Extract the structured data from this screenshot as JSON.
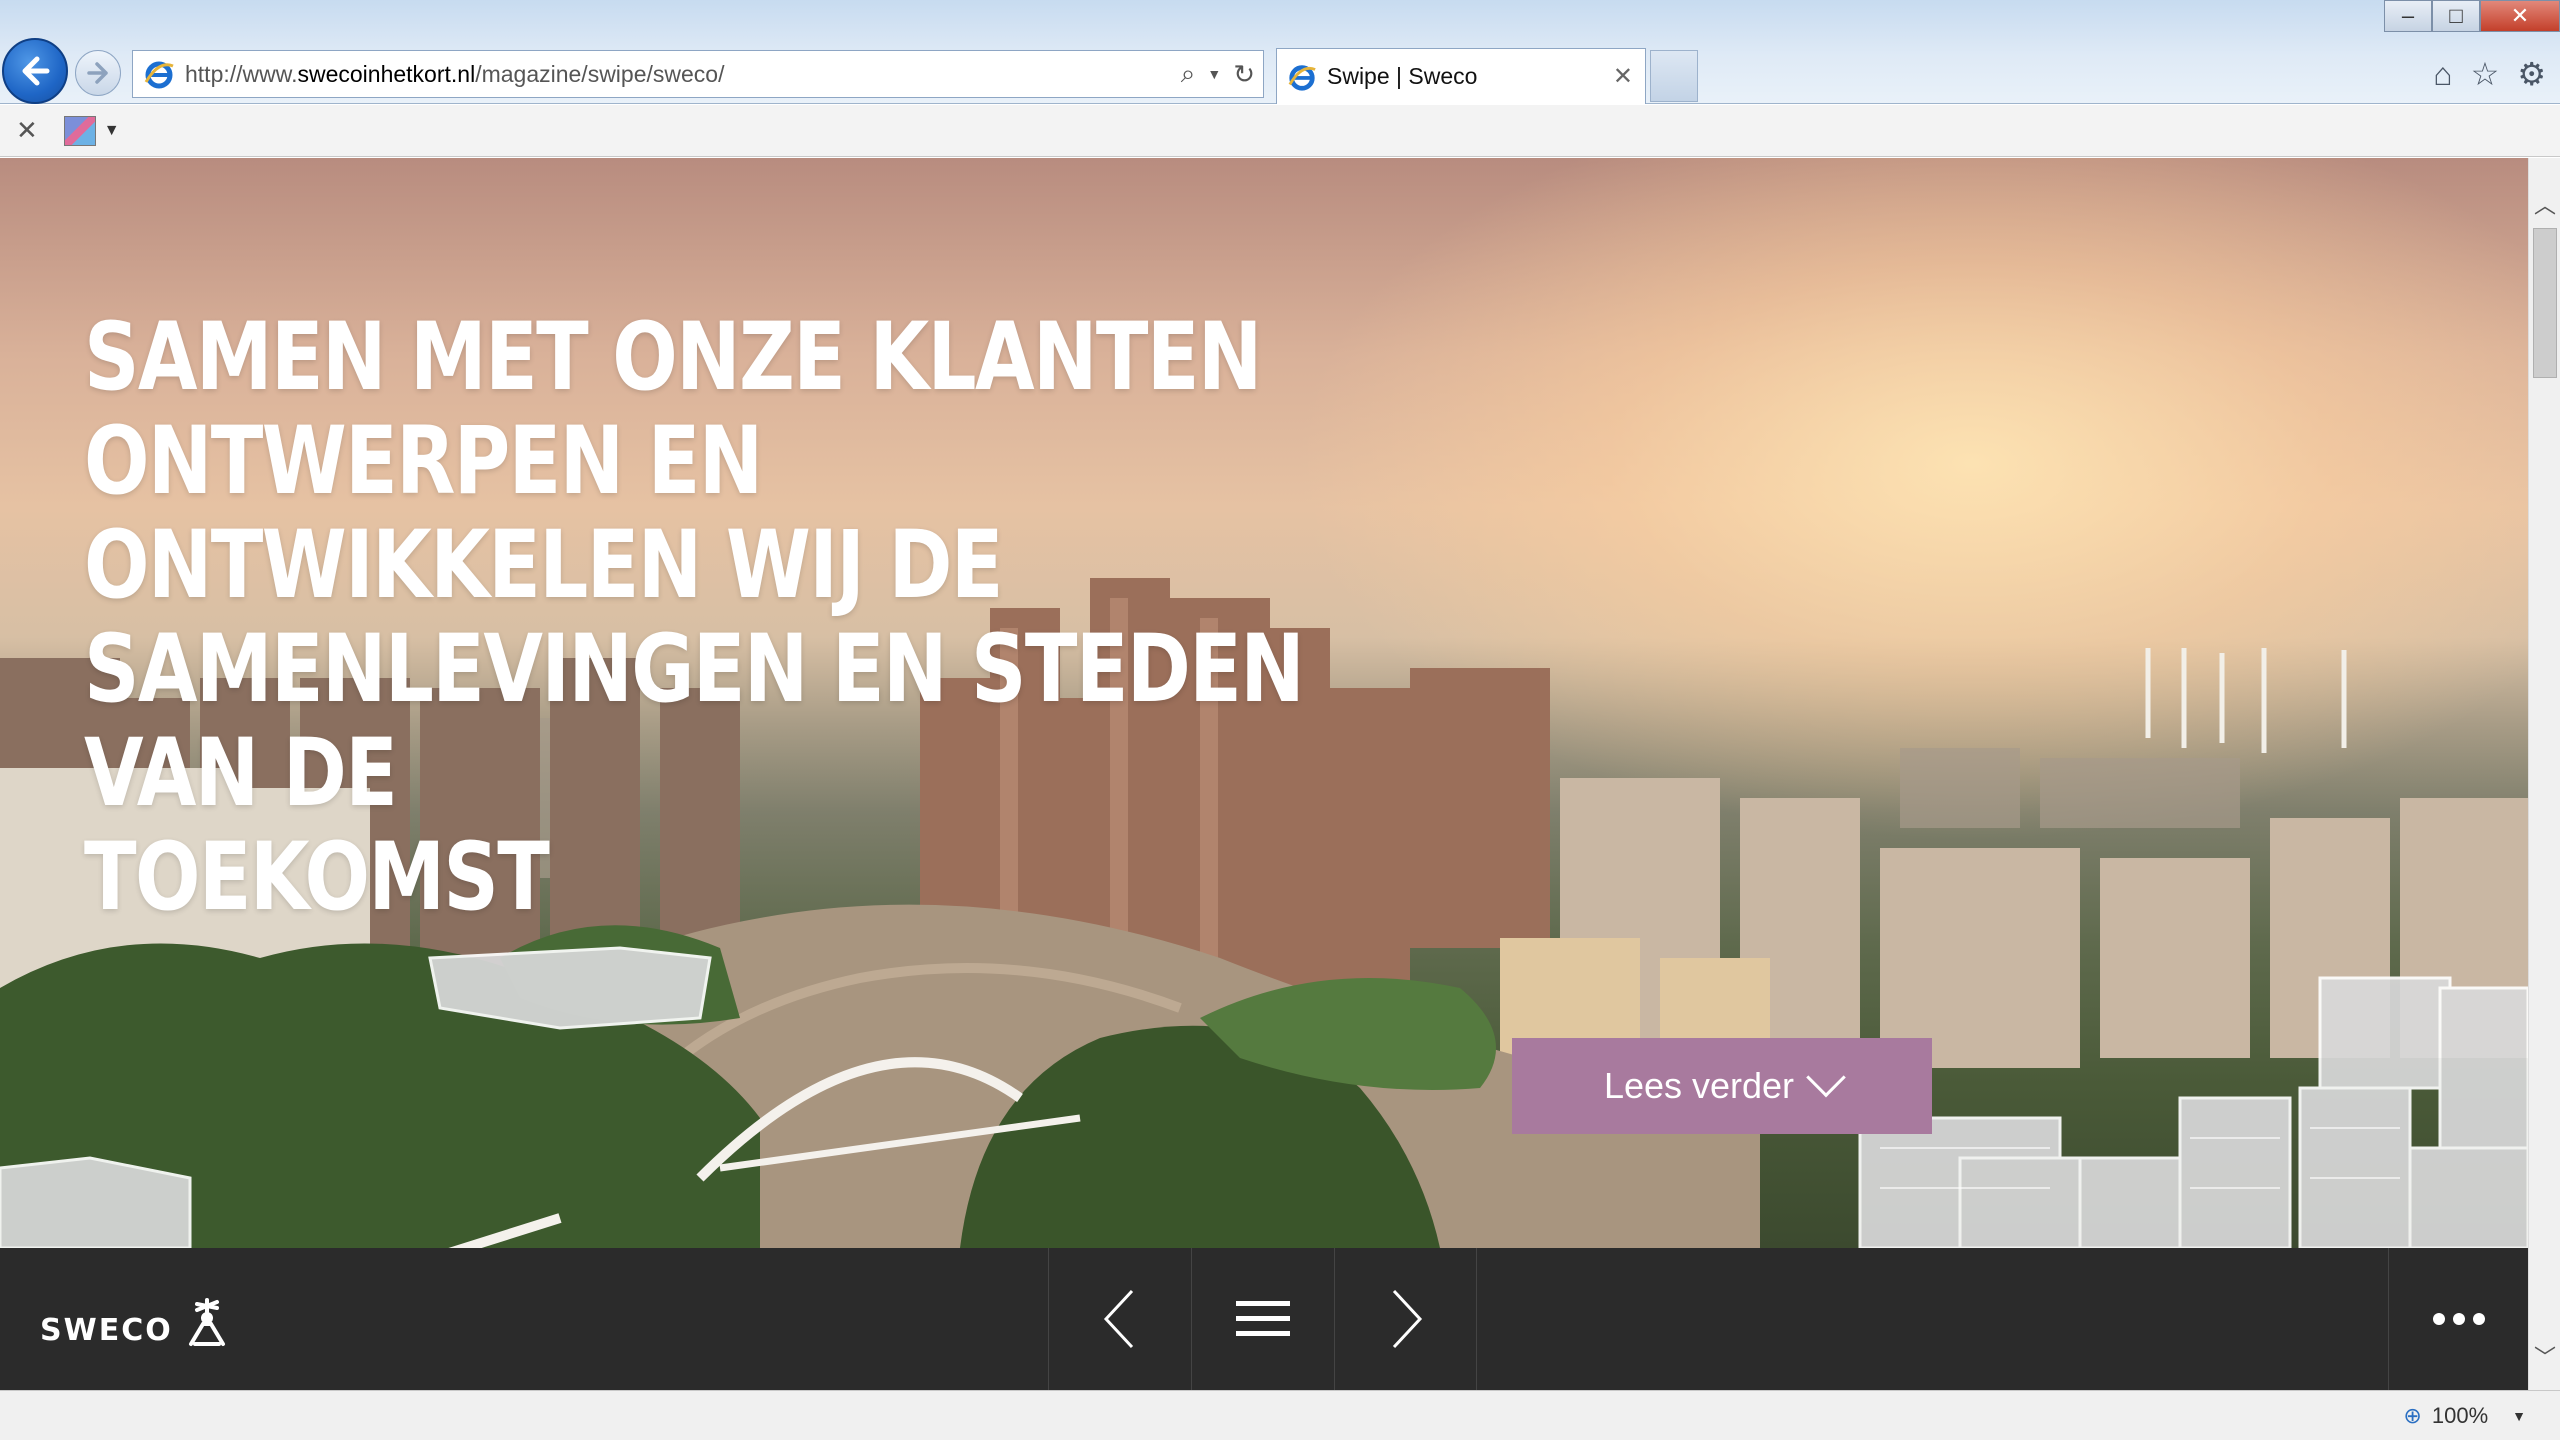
{
  "browser": {
    "url_prefix": "http://www.",
    "url_domain": "swecoinhetkort.nl",
    "url_path": "/magazine/swipe/sweco/",
    "tab_title": "Swipe | Sweco",
    "zoom": "100%"
  },
  "icons": {
    "back": "back-arrow-icon",
    "forward": "forward-arrow-icon",
    "search": "search-icon",
    "refresh": "refresh-icon",
    "home": "home-icon",
    "favorites": "star-icon",
    "settings": "gear-icon"
  },
  "hero": {
    "headline_lines": [
      "SAMEN MET ONZE KLANTEN",
      "ONTWERPEN EN ONTWIKKELEN WIJ DE",
      "SAMENLEVINGEN EN STEDEN VAN DE",
      "TOEKOMST"
    ],
    "cta_label": "Lees verder"
  },
  "footer": {
    "logo_text": "SWECO"
  },
  "colors": {
    "accent": "#a87a9e",
    "navbar": "#2b2b2b"
  }
}
